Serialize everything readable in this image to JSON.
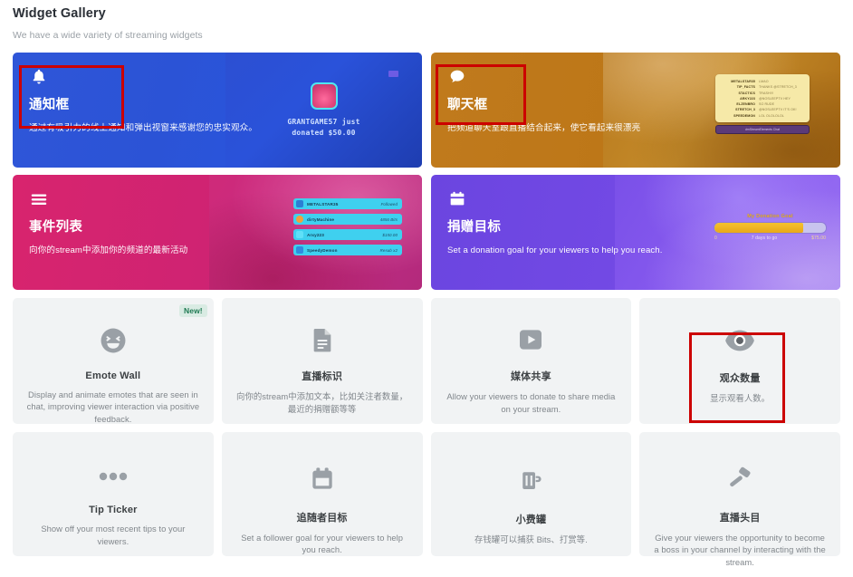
{
  "header": {
    "title": "Widget Gallery",
    "subtitle": "We have a wide variety of streaming widgets"
  },
  "featured": [
    {
      "id": "alertbox",
      "icon": "bell-icon",
      "title": "通知框",
      "desc": "通过有吸引力的线上通知和弹出视窗来感谢您的忠实观众。",
      "accent": "#2f56d8",
      "preview": {
        "type": "alert-popup",
        "line1": "GRANTGAME57 just",
        "line2": "donated $50.00"
      }
    },
    {
      "id": "chatbox",
      "icon": "chat-bubble-icon",
      "title": "聊天框",
      "desc": "把频道聊天室跟直播结合起来，使它看起来很漂亮",
      "accent": "#bd7718",
      "preview": {
        "type": "chat-panel",
        "rows": [
          {
            "user": "METALSTAR35",
            "msg": "LMAO"
          },
          {
            "user": "TIP_FACTS",
            "msg": "THANKS @STRETCH_3"
          },
          {
            "user": "STACTICS",
            "msg": "TRASH!!!"
          },
          {
            "user": "ARKY223",
            "msg": "@NOSLEEPTV HEY"
          },
          {
            "user": "ELZENBRO",
            "msg": "SO RUDE"
          },
          {
            "user": "STRETCH_3",
            "msg": "@NOSLEEPTV IT'S OK!"
          },
          {
            "user": "SPEEDEMON",
            "msg": "LOL OLOLOLOL"
          }
        ],
        "footer": "dmStreamElements Chat"
      }
    },
    {
      "id": "eventlist",
      "icon": "list-icon",
      "title": "事件列表",
      "desc": "向你的stream中添加你的频道的最新活动",
      "accent": "#cf2372",
      "preview": {
        "type": "event-list",
        "rows": [
          {
            "name": "METALSTAR35",
            "value": "Followed"
          },
          {
            "name": "dirtyMachine",
            "value": "4856 Bits"
          },
          {
            "name": "Arxy223",
            "value": "$150.00"
          },
          {
            "name": "SpeedyDemon",
            "value": "Resub x2"
          }
        ]
      }
    },
    {
      "id": "donationgoal",
      "icon": "calendar-icon",
      "title": "捐赠目标",
      "desc": "Set a donation goal for your viewers to help you reach.",
      "accent": "#7249e4",
      "preview": {
        "type": "goal-bar",
        "goal_title": "My Donation Goal",
        "axis_min": "0",
        "axis_mid": "7 days to go",
        "axis_max": "$75.00",
        "progress_percent": 80
      }
    }
  ],
  "widgets": [
    {
      "id": "emote-wall",
      "icon": "laughing-face-icon",
      "badge": "New!",
      "title": "Emote Wall",
      "desc": "Display and animate emotes that are seen in chat, improving viewer interaction via positive feedback."
    },
    {
      "id": "stream-label",
      "icon": "document-icon",
      "badge": "",
      "title": "直播标识",
      "desc": "向你的stream中添加文本，比如关注者数量，最近的捐赠额等等"
    },
    {
      "id": "media-share",
      "icon": "play-icon",
      "badge": "",
      "title": "媒体共享",
      "desc": "Allow your viewers to donate to share media on your stream."
    },
    {
      "id": "viewer-count",
      "icon": "eye-icon",
      "badge": "",
      "title": "观众数量",
      "desc": "显示观看人数。"
    },
    {
      "id": "tip-ticker",
      "icon": "ellipsis-icon",
      "badge": "",
      "title": "Tip Ticker",
      "desc": "Show off your most recent tips to your viewers."
    },
    {
      "id": "follower-goal",
      "icon": "calendar-icon",
      "badge": "",
      "title": "追随者目标",
      "desc": "Set a follower goal for your viewers to help you reach."
    },
    {
      "id": "tip-jar",
      "icon": "beer-mug-icon",
      "badge": "",
      "title": "小费罐",
      "desc": "存钱罐可以捕获 Bits、打赏等."
    },
    {
      "id": "stream-boss",
      "icon": "hammer-icon",
      "badge": "",
      "title": "直播头目",
      "desc": "Give your viewers the opportunity to become a boss in your channel by interacting with the stream."
    }
  ],
  "annotations": {
    "highlight_color": "#cc0000",
    "boxes": [
      "alertbox-title-region",
      "chatbox-title-region",
      "viewer-count-card"
    ]
  }
}
